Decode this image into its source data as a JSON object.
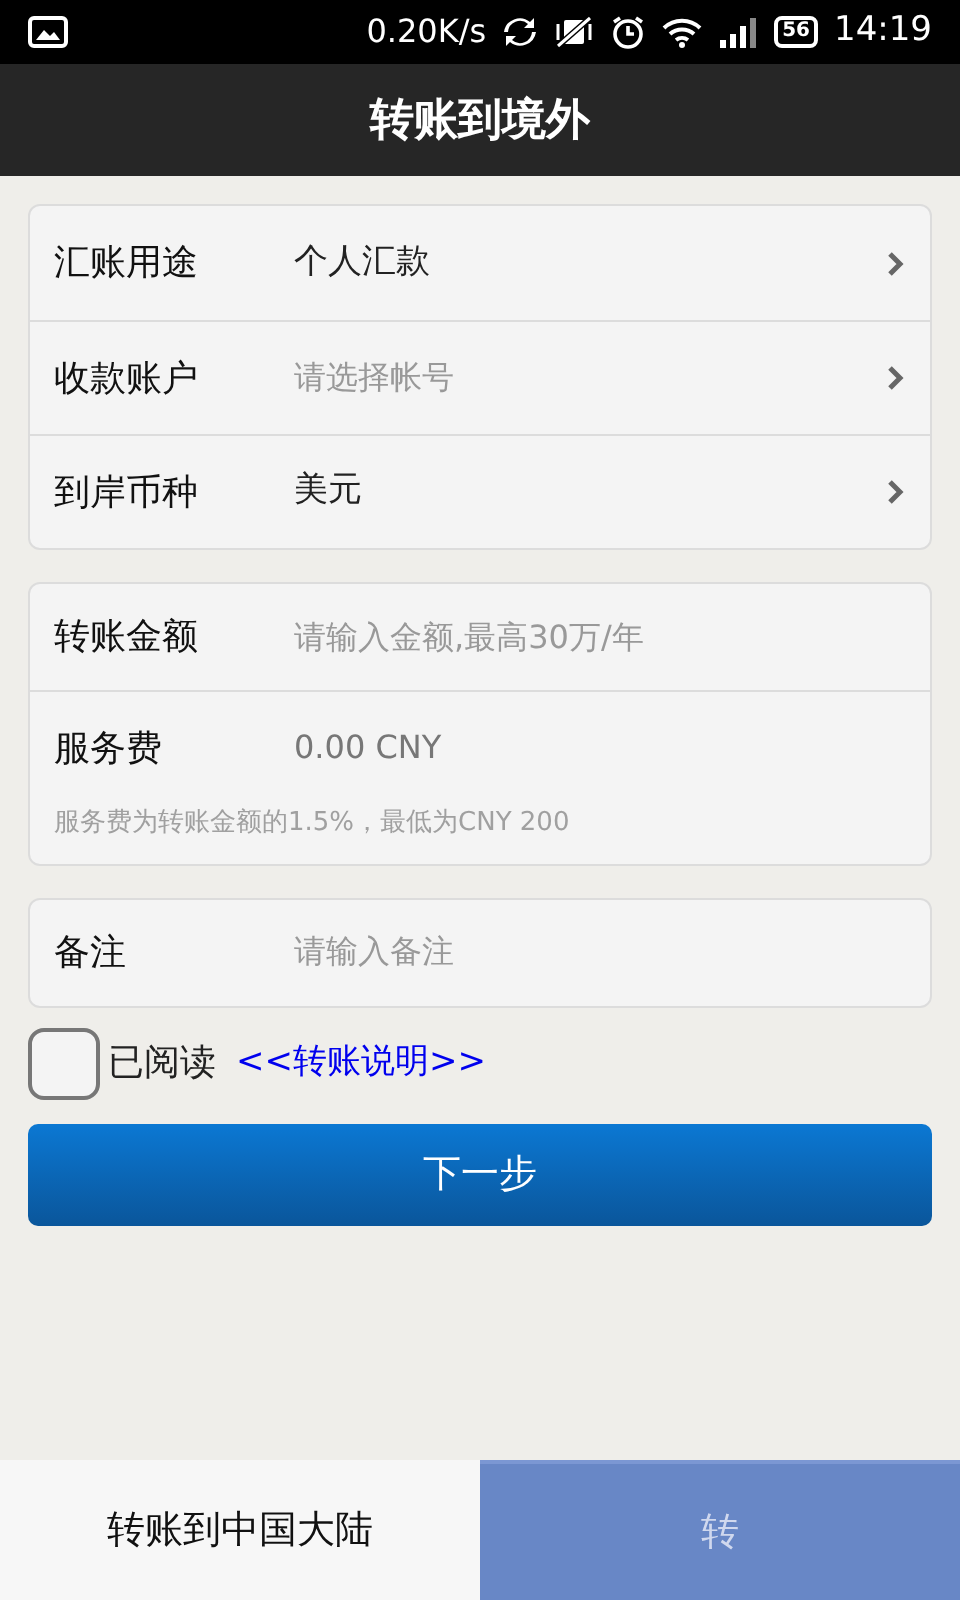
{
  "status_bar": {
    "speed": "0.20K/s",
    "battery": "56",
    "time": "14:19"
  },
  "header": {
    "title": "转账到境外"
  },
  "groups": [
    {
      "rows": [
        {
          "kind": "select",
          "label": "汇账用途",
          "value": "个人汇款"
        },
        {
          "kind": "select",
          "label": "收款账户",
          "placeholder": "请选择帐号"
        },
        {
          "kind": "select",
          "label": "到岸币种",
          "value": "美元"
        }
      ]
    },
    {
      "rows": [
        {
          "kind": "input",
          "label": "转账金额",
          "placeholder": "请输入金额,最高30万/年"
        },
        {
          "kind": "fee",
          "label": "服务费",
          "value": "0.00 CNY",
          "note": "服务费为转账金额的1.5%，最低为CNY 200"
        }
      ]
    },
    {
      "rows": [
        {
          "kind": "input",
          "label": "备注",
          "placeholder": "请输入备注"
        }
      ]
    }
  ],
  "agreement": {
    "checked": false,
    "label": "已阅读",
    "link": "<<转账说明>>"
  },
  "next_button": "下一步",
  "tabs": [
    {
      "label": "转账到中国大陆",
      "selected": false
    },
    {
      "label": "转",
      "selected": true
    }
  ]
}
